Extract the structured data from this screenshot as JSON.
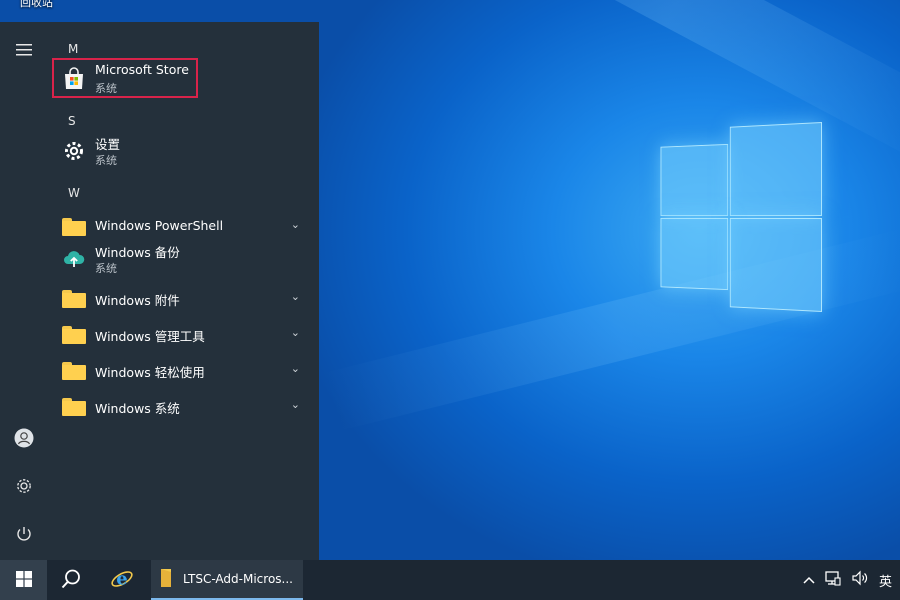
{
  "desktop": {
    "label": "回收站"
  },
  "start_menu": {
    "sections": [
      {
        "letter": "M"
      },
      {
        "letter": "S"
      },
      {
        "letter": "W"
      }
    ],
    "apps": [
      {
        "name": "Microsoft Store",
        "subtitle": "系统"
      },
      {
        "name": "设置",
        "subtitle": "系统"
      },
      {
        "name": "Windows PowerShell"
      },
      {
        "name": "Windows 备份",
        "subtitle": "系统"
      },
      {
        "name": "Windows 附件"
      },
      {
        "name": "Windows 管理工具"
      },
      {
        "name": "Windows 轻松使用"
      },
      {
        "name": "Windows 系统"
      }
    ]
  },
  "taskbar": {
    "explorer_window_title": "LTSC-Add-Micros...",
    "ime_indicator": "英"
  },
  "colors": {
    "start_bg": "#24303b",
    "taskbar_bg": "#1c2733",
    "highlight": "#d9234a",
    "folder": "#ffd04f"
  }
}
